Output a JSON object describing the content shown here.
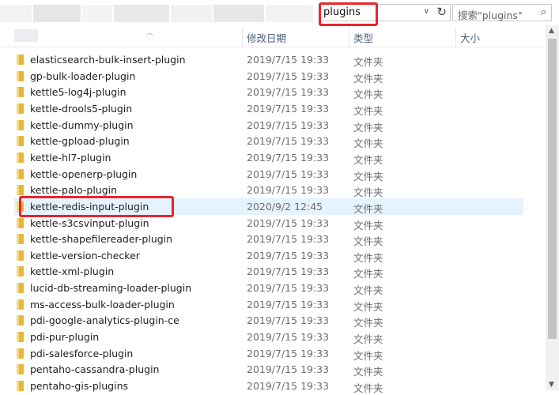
{
  "toolbar": {
    "address_value": "plugins",
    "search_placeholder": "搜索\"plugins\"",
    "dropdown_glyph": "∨",
    "refresh_glyph": "↻",
    "search_glyph": "⌕"
  },
  "columns": {
    "date": "修改日期",
    "type": "类型",
    "size": "大小"
  },
  "rows": [
    {
      "name": "elasticsearch-bulk-insert-plugin",
      "date": "2019/7/15 19:33",
      "type": "文件夹"
    },
    {
      "name": "gp-bulk-loader-plugin",
      "date": "2019/7/15 19:33",
      "type": "文件夹"
    },
    {
      "name": "kettle5-log4j-plugin",
      "date": "2019/7/15 19:33",
      "type": "文件夹"
    },
    {
      "name": "kettle-drools5-plugin",
      "date": "2019/7/15 19:33",
      "type": "文件夹"
    },
    {
      "name": "kettle-dummy-plugin",
      "date": "2019/7/15 19:33",
      "type": "文件夹"
    },
    {
      "name": "kettle-gpload-plugin",
      "date": "2019/7/15 19:33",
      "type": "文件夹"
    },
    {
      "name": "kettle-hl7-plugin",
      "date": "2019/7/15 19:33",
      "type": "文件夹"
    },
    {
      "name": "kettle-openerp-plugin",
      "date": "2019/7/15 19:33",
      "type": "文件夹"
    },
    {
      "name": "kettle-palo-plugin",
      "date": "2019/7/15 19:33",
      "type": "文件夹"
    },
    {
      "name": "kettle-redis-input-plugin",
      "date": "2020/9/2 12:45",
      "type": "文件夹"
    },
    {
      "name": "kettle-s3csvinput-plugin",
      "date": "2019/7/15 19:33",
      "type": "文件夹"
    },
    {
      "name": "kettle-shapefilereader-plugin",
      "date": "2019/7/15 19:33",
      "type": "文件夹"
    },
    {
      "name": "kettle-version-checker",
      "date": "2019/7/15 19:33",
      "type": "文件夹"
    },
    {
      "name": "kettle-xml-plugin",
      "date": "2019/7/15 19:33",
      "type": "文件夹"
    },
    {
      "name": "lucid-db-streaming-loader-plugin",
      "date": "2019/7/15 19:33",
      "type": "文件夹"
    },
    {
      "name": "ms-access-bulk-loader-plugin",
      "date": "2019/7/15 19:33",
      "type": "文件夹"
    },
    {
      "name": "pdi-google-analytics-plugin-ce",
      "date": "2019/7/15 19:33",
      "type": "文件夹"
    },
    {
      "name": "pdi-pur-plugin",
      "date": "2019/7/15 19:33",
      "type": "文件夹"
    },
    {
      "name": "pdi-salesforce-plugin",
      "date": "2019/7/15 19:33",
      "type": "文件夹"
    },
    {
      "name": "pentaho-cassandra-plugin",
      "date": "2019/7/15 19:33",
      "type": "文件夹"
    },
    {
      "name": "pentaho-gis-plugins",
      "date": "2019/7/15 19:33",
      "type": "文件夹"
    }
  ],
  "selected_index": 9,
  "colors": {
    "highlight": "#e8262c",
    "selected_row": "#e5f3ff",
    "folder": "#e8b53f"
  }
}
